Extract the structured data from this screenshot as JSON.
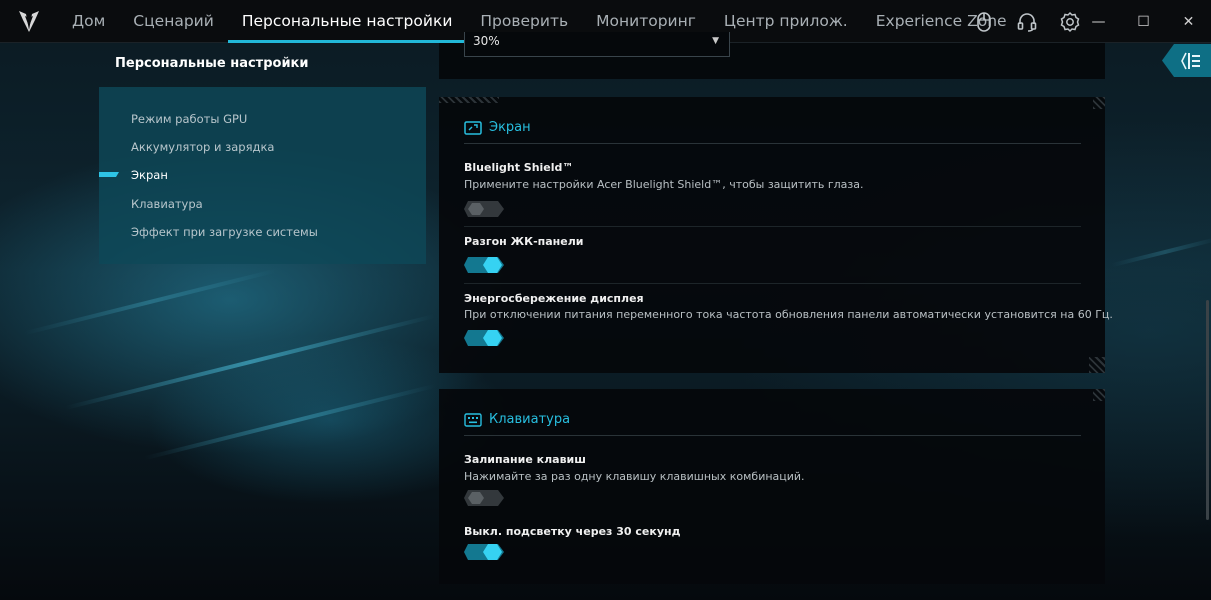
{
  "app": {
    "nav": [
      {
        "label": "Дом"
      },
      {
        "label": "Сценарий"
      },
      {
        "label": "Персональные настройки"
      },
      {
        "label": "Проверить"
      },
      {
        "label": "Мониторинг"
      },
      {
        "label": "Центр прилож."
      },
      {
        "label": "Experience Zone"
      }
    ],
    "top_icons": [
      "mouse-icon",
      "headset-icon",
      "gear-icon"
    ],
    "window_controls": {
      "minimize": "—",
      "maximize": "☐",
      "close": "✕"
    }
  },
  "sidebar": {
    "title": "Персональные настройки",
    "items": [
      {
        "label": "Режим работы GPU",
        "active": false
      },
      {
        "label": "Аккумулятор и зарядка",
        "active": false
      },
      {
        "label": "Экран",
        "active": true
      },
      {
        "label": "Клавиатура",
        "active": false
      },
      {
        "label": "Эффект при загрузке системы",
        "active": false
      }
    ]
  },
  "top_select": {
    "value": "30%",
    "arrow": "▼"
  },
  "display_section": {
    "title": "Экран",
    "icon": "display-icon",
    "options": [
      {
        "title": "Bluelight Shield™",
        "desc": "Примените настройки Acer Bluelight Shield™, чтобы защитить глаза.",
        "on": false
      },
      {
        "title": "Разгон ЖК-панели",
        "desc": "",
        "on": true
      },
      {
        "title": "Энергосбережение дисплея",
        "desc": "При отключении питания переменного тока частота обновления панели автоматически установится на 60 Гц.",
        "on": true
      }
    ]
  },
  "keyboard_section": {
    "title": "Клавиатура",
    "icon": "keyboard-icon",
    "options": [
      {
        "title": "Залипание клавиш",
        "desc": "Нажимайте за раз одну клавишу клавишных комбинаций.",
        "on": false
      },
      {
        "title": "Выкл. подсветку через 30 секунд",
        "desc": "",
        "on": true
      }
    ]
  },
  "colors": {
    "accent": "#22b8d8",
    "toggle_on": "#2ec4e6",
    "toggle_off": "#3a3f43"
  }
}
